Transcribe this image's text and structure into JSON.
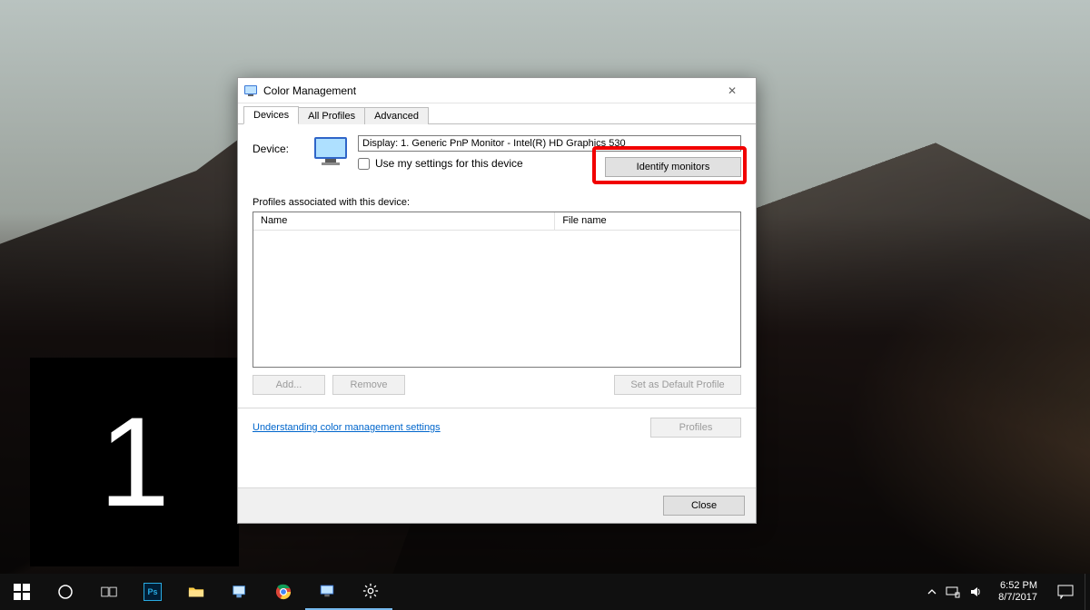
{
  "dialog": {
    "title": "Color Management",
    "tabs": [
      "Devices",
      "All Profiles",
      "Advanced"
    ],
    "active_tab": 0,
    "device_label": "Device:",
    "device_value": "Display: 1. Generic PnP Monitor - Intel(R) HD Graphics 530",
    "use_my_settings_label": "Use my settings for this device",
    "use_my_settings_checked": false,
    "identify_button": "Identify monitors",
    "profiles_label": "Profiles associated with this device:",
    "columns": {
      "name": "Name",
      "file": "File name"
    },
    "add_button": "Add...",
    "remove_button": "Remove",
    "set_default_button": "Set as Default Profile",
    "profiles_button": "Profiles",
    "help_link": "Understanding color management settings",
    "close_button": "Close"
  },
  "identify_overlay": {
    "number": "1"
  },
  "taskbar": {
    "time": "6:52 PM",
    "date": "8/7/2017",
    "apps": [
      "start",
      "cortana-search",
      "task-view",
      "photoshop",
      "file-explorer",
      "paint",
      "chrome",
      "color-management",
      "settings"
    ],
    "tray": [
      "chevron-up",
      "network",
      "volume"
    ]
  },
  "highlight": {
    "target": "identify-monitors-button",
    "color": "#f10000"
  }
}
